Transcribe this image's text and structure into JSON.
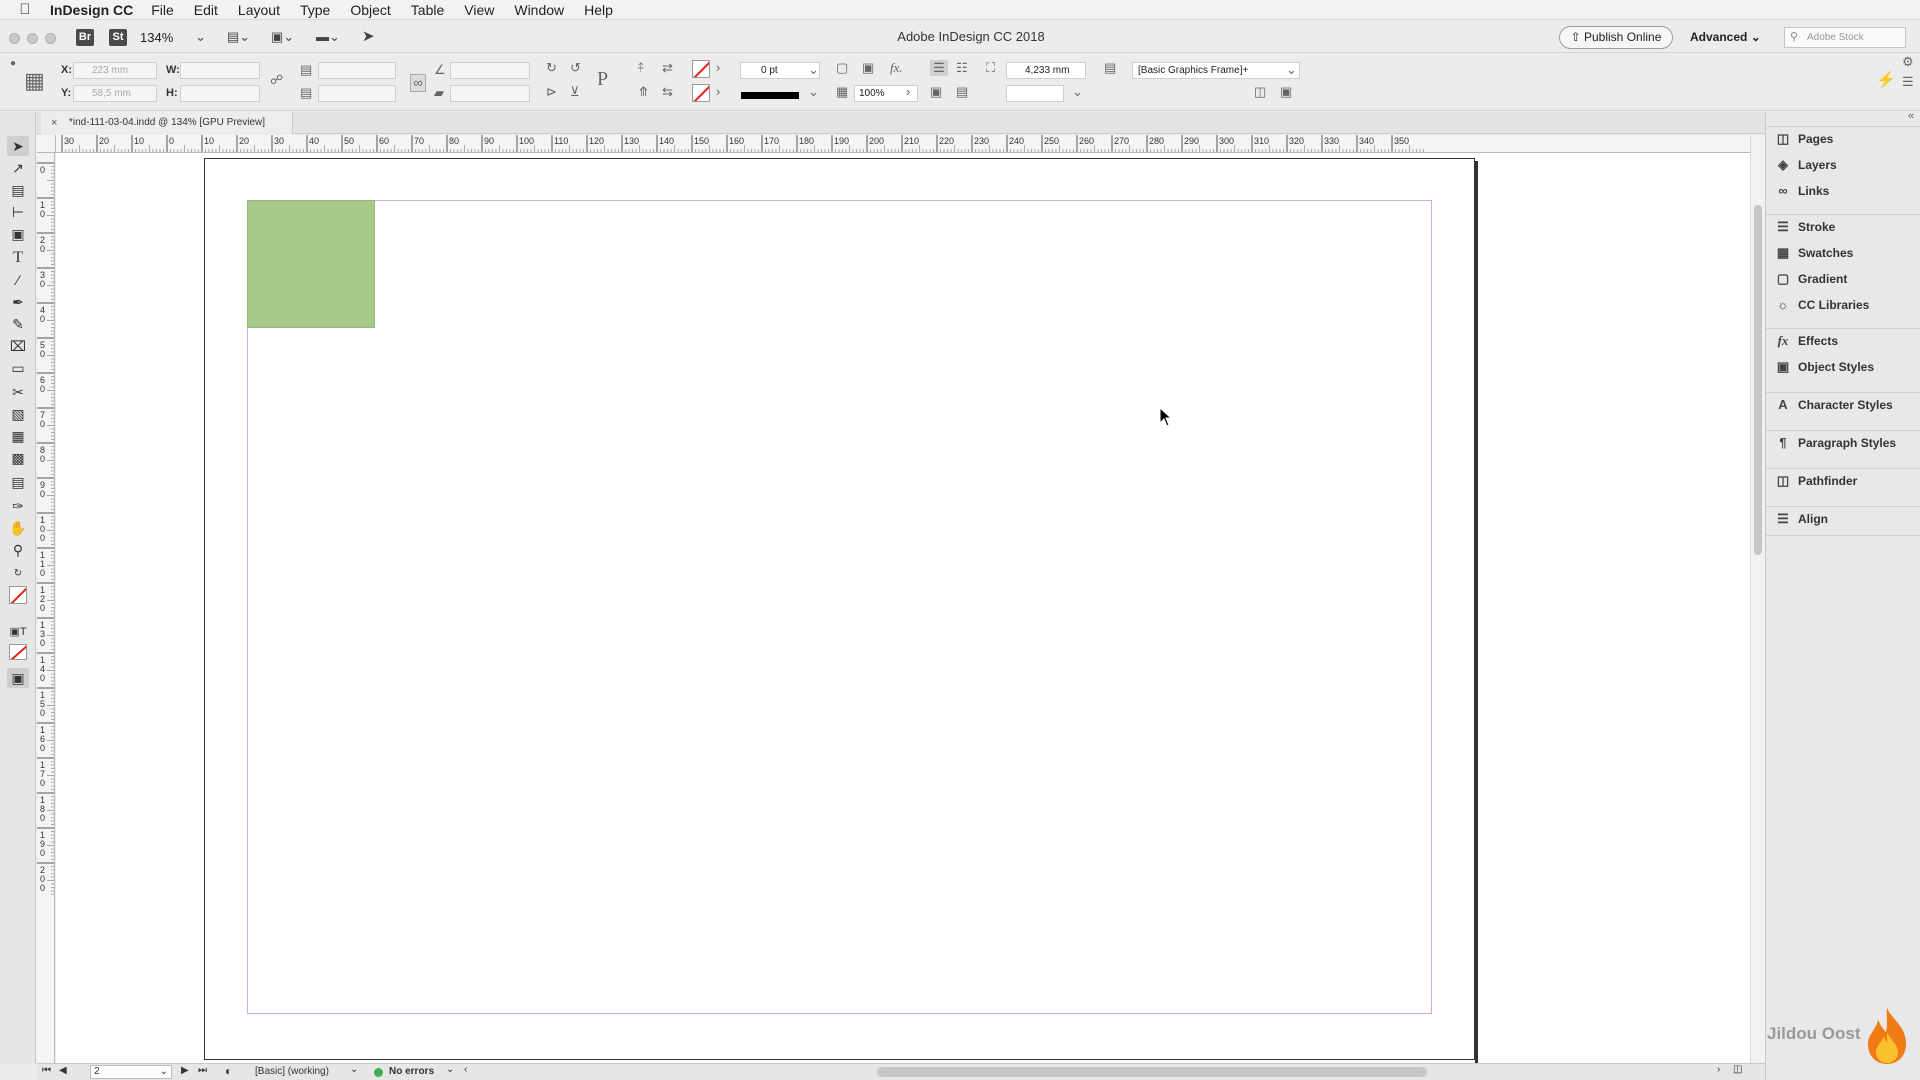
{
  "menubar": {
    "app_name": "InDesign CC",
    "menus": [
      "File",
      "Edit",
      "Layout",
      "Type",
      "Object",
      "Table",
      "View",
      "Window",
      "Help"
    ]
  },
  "appbar": {
    "badge_br": "Br",
    "badge_st": "St",
    "zoom": "134%",
    "title": "Adobe InDesign CC 2018",
    "publish_label": "Publish Online",
    "workspace": "Advanced",
    "search_placeholder": "Adobe Stock"
  },
  "control": {
    "x_label": "X:",
    "y_label": "Y:",
    "w_label": "W:",
    "h_label": "H:",
    "x_value": "223 mm",
    "y_value": "58,5 mm",
    "stroke_weight": "0 pt",
    "scale_percent": "100%",
    "dimension_value": "4,233 mm",
    "object_style": "[Basic Graphics Frame]+"
  },
  "tab": {
    "label": "*ind-111-03-04.indd @ 134% [GPU Preview]"
  },
  "ruler_top_labels": [
    "30",
    "20",
    "10",
    "0",
    "10",
    "20",
    "30",
    "40",
    "50",
    "60",
    "70",
    "80",
    "90",
    "100",
    "110",
    "120",
    "130",
    "140",
    "150",
    "160",
    "170",
    "180",
    "190",
    "200",
    "210",
    "220",
    "230",
    "240",
    "250",
    "260",
    "270",
    "280",
    "290",
    "300",
    "310",
    "320",
    "330",
    "340",
    "350"
  ],
  "ruler_left_labels": [
    "0",
    "10",
    "20",
    "30",
    "40",
    "50",
    "60",
    "70",
    "80",
    "90",
    "100",
    "110",
    "120",
    "130",
    "140",
    "150",
    "160",
    "170",
    "180",
    "190",
    "200"
  ],
  "panels": {
    "groups": [
      [
        {
          "label": "Pages",
          "icon": "pages-icon"
        },
        {
          "label": "Layers",
          "icon": "layers-icon"
        },
        {
          "label": "Links",
          "icon": "links-icon"
        }
      ],
      [
        {
          "label": "Stroke",
          "icon": "stroke-icon"
        },
        {
          "label": "Swatches",
          "icon": "swatches-icon"
        },
        {
          "label": "Gradient",
          "icon": "gradient-icon"
        },
        {
          "label": "CC Libraries",
          "icon": "cc-libraries-icon"
        }
      ],
      [
        {
          "label": "Effects",
          "icon": "effects-icon"
        },
        {
          "label": "Object Styles",
          "icon": "object-styles-icon"
        }
      ],
      [
        {
          "label": "Character Styles",
          "icon": "character-styles-icon"
        }
      ],
      [
        {
          "label": "Paragraph Styles",
          "icon": "paragraph-styles-icon"
        }
      ],
      [
        {
          "label": "Pathfinder",
          "icon": "pathfinder-icon"
        }
      ],
      [
        {
          "label": "Align",
          "icon": "align-icon"
        }
      ]
    ]
  },
  "status": {
    "page_number": "2",
    "preflight_profile": "[Basic] (working)",
    "errors": "No errors"
  },
  "watermark": "Jildou Oost",
  "colors": {
    "frame_fill": "#a7ca89",
    "margin_guide": "#d9a8d9",
    "status_ok": "#3dae4b"
  }
}
